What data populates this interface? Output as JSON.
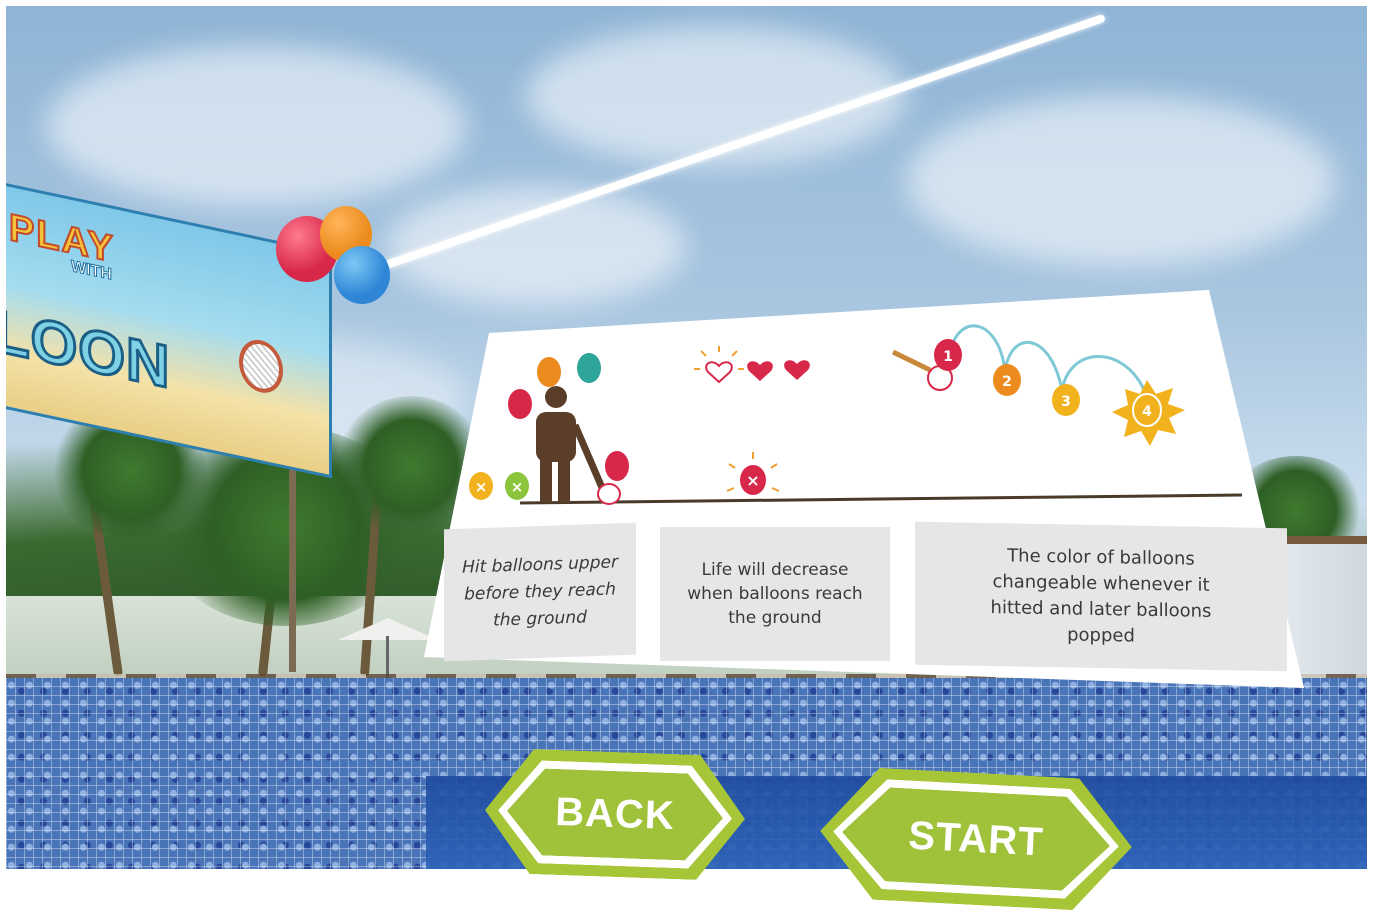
{
  "banner": {
    "title_line1": "PLAY",
    "title_small": "WITH",
    "title_line2": "LOON"
  },
  "instructions": [
    {
      "text": "Hit balloons upper\nbefore they reach\nthe ground"
    },
    {
      "text": "Life will decrease\nwhen balloons reach\nthe ground"
    },
    {
      "text": "The color of balloons\nchangeable whenever it\nhitted and later balloons\npopped"
    }
  ],
  "illustration": {
    "sequence_numbers": [
      "1",
      "2",
      "3",
      "4"
    ],
    "balloon_colors": {
      "red": "#d8284a",
      "orange": "#ec8c1e",
      "yellow": "#f2b21e",
      "teal": "#2fa59a",
      "green": "#8cc43c"
    },
    "figure_color": "#5a3e2a",
    "icons": [
      "life-heart-outline-icon",
      "life-heart-icon",
      "life-heart-icon",
      "popped-balloon-icon",
      "racket-icon"
    ]
  },
  "buttons": {
    "back_label": "BACK",
    "start_label": "START",
    "color": "#a6c637"
  }
}
